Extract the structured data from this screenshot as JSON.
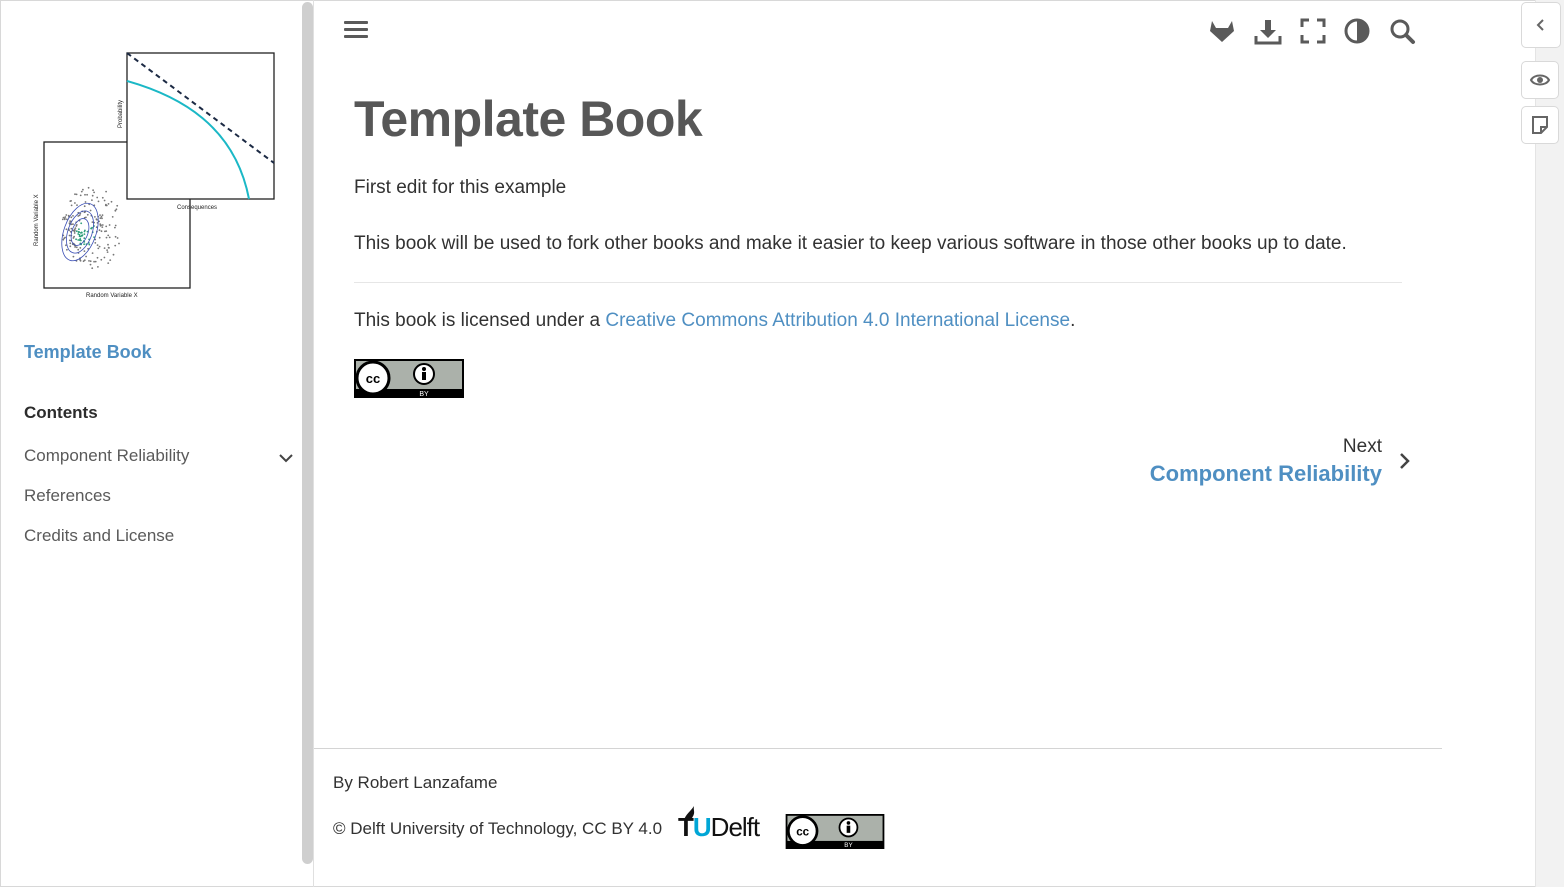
{
  "sidebar": {
    "logo_labels": {
      "probability": "Probability",
      "consequences": "Consequences",
      "random_var_x2": "Random Variable X",
      "random_var_x1": "Random Variable X"
    },
    "book_title": "Template Book",
    "contents_caption": "Contents",
    "nav_items": [
      {
        "label": "Component Reliability",
        "expandable": true
      },
      {
        "label": "References"
      },
      {
        "label": "Credits and License"
      }
    ]
  },
  "header": {
    "tools": [
      "gitlab-icon",
      "download-icon",
      "fullscreen-icon",
      "theme-toggle-icon",
      "search-icon"
    ]
  },
  "main": {
    "title": "Template Book",
    "para1": "First edit for this example",
    "para2": "This book will be used to fork other books and make it easier to keep various software in those other books up to date.",
    "license_prefix": "This book is licensed under a ",
    "license_link": "Creative Commons Attribution 4.0 International License",
    "license_suffix": ".",
    "cc_badge": {
      "cc": "cc",
      "by": "BY"
    }
  },
  "next": {
    "caption": "Next",
    "title": "Component Reliability"
  },
  "footer": {
    "author": "By Robert Lanzafame",
    "copyright": "© Delft University of Technology, CC BY 4.0",
    "tu_logo": {
      "tu": "T",
      "u": "U",
      "delft": "Delft"
    }
  },
  "rail": {
    "buttons": [
      "collapse-icon",
      "eye-icon",
      "annotation-icon"
    ]
  },
  "colors": {
    "link": "#4f8fc2",
    "text": "#323232",
    "title": "#575757",
    "tu_blue": "#00a6d6"
  }
}
